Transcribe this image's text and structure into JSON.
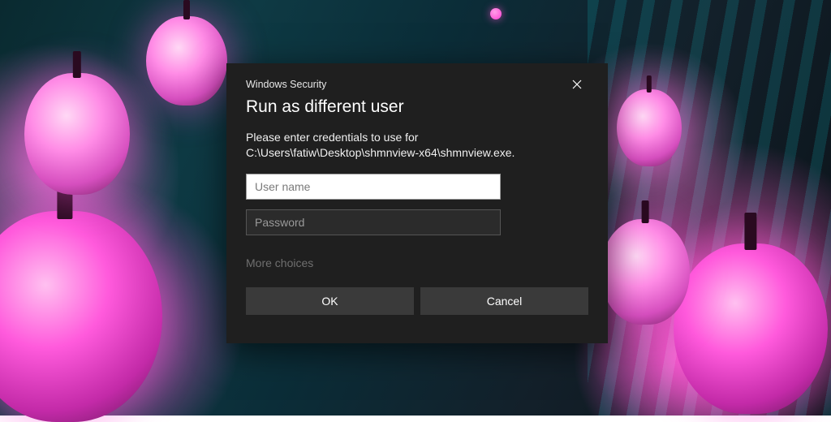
{
  "dialog": {
    "caption": "Windows Security",
    "title": "Run as different user",
    "message": "Please enter credentials to use for C:\\Users\\fatiw\\Desktop\\shmnview-x64\\shmnview.exe.",
    "username_placeholder": "User name",
    "username_value": "",
    "password_placeholder": "Password",
    "password_value": "",
    "more_choices": "More choices",
    "ok_label": "OK",
    "cancel_label": "Cancel"
  }
}
